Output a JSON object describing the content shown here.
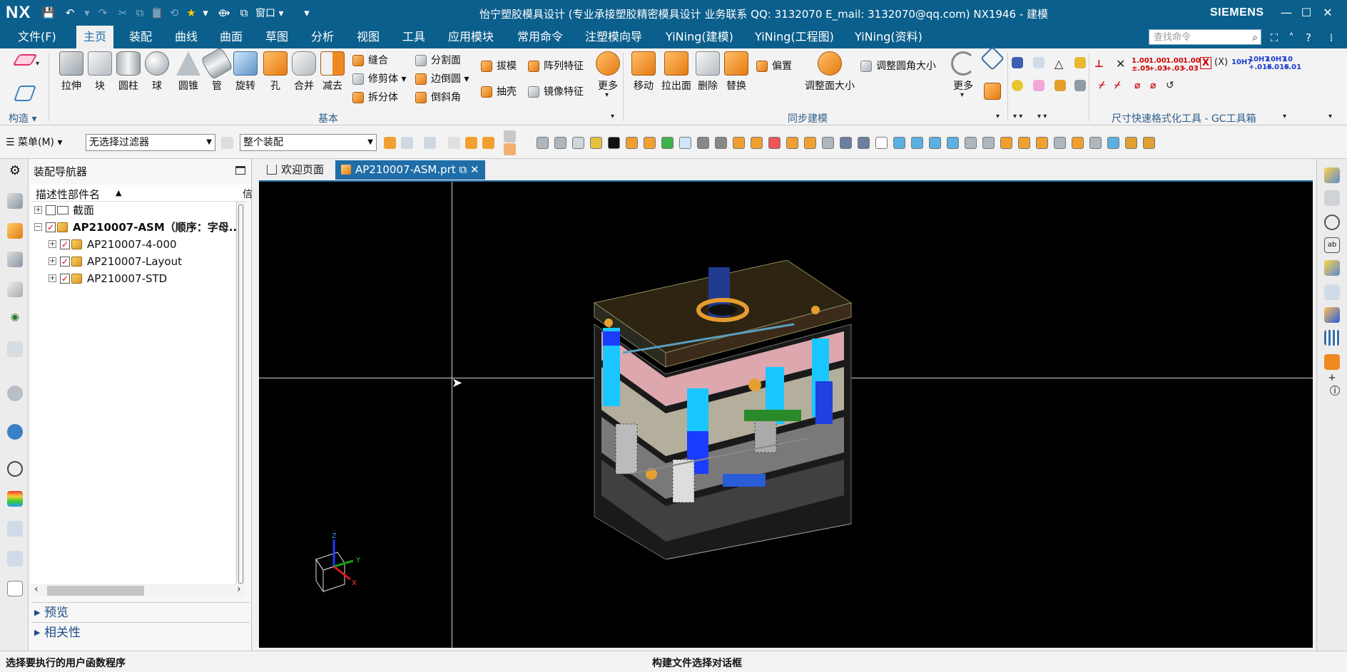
{
  "app": {
    "logo": "NX",
    "window_menu": "窗口",
    "title": "怡宁塑胶模具设计 (专业承接塑胶精密模具设计 业务联系 QQ: 3132070    E_mail: 3132070@qq.com)  NX1946 - 建模",
    "brand": "SIEMENS"
  },
  "menubar": {
    "items": [
      "文件(F)",
      "主页",
      "装配",
      "曲线",
      "曲面",
      "草图",
      "分析",
      "视图",
      "工具",
      "应用模块",
      "常用命令",
      "注塑模向导",
      "YiNing(建模)",
      "YiNing(工程图)",
      "YiNing(资料)"
    ],
    "active_index": 1,
    "search_placeholder": "查找命令"
  },
  "ribbon": {
    "construct": {
      "label": "构造"
    },
    "basic": {
      "label": "基本",
      "large": [
        "拉伸",
        "块",
        "圆柱",
        "球",
        "圆锥",
        "管",
        "旋转",
        "孔",
        "合并",
        "减去"
      ],
      "small_col1": [
        "缝合",
        "修剪体",
        "拆分体"
      ],
      "small_col2": [
        "分割面",
        "边倒圆",
        "倒斜角"
      ],
      "small_col3": [
        "拔模",
        "抽壳"
      ],
      "small_col4": [
        "阵列特征",
        "镜像特征"
      ],
      "more": "更多"
    },
    "sync": {
      "label": "同步建模",
      "large": [
        "移动",
        "拉出面",
        "删除",
        "替换"
      ],
      "offset": "偏置",
      "resize_fillet": "调整圆角大小",
      "resize": "调整面大小",
      "more": "更多"
    },
    "gc": {
      "label": "尺寸快速格式化工具 - GC工具箱",
      "tiny": [
        "1.00\n±.05",
        "1.00\n+.03",
        "1.00\n+.03",
        "1.00\n-.03",
        "10H7",
        "10H7\n+.015",
        "10H7\n+.015",
        "10\n+.01"
      ]
    }
  },
  "selbar": {
    "menu": "菜单(M)",
    "filter": "无选择过滤器",
    "scope": "整个装配"
  },
  "navigator": {
    "title": "装配导航器",
    "col1": "描述性部件名",
    "col2": "信",
    "rows": [
      {
        "label": "截面",
        "bold": false,
        "level": 0,
        "expander": "+",
        "checked": false,
        "icon": "folder"
      },
      {
        "label": "AP210007-ASM（顺序：字母...",
        "bold": true,
        "level": 0,
        "expander": "−",
        "checked": true,
        "icon": "assembly"
      },
      {
        "label": "AP210007-4-000",
        "bold": false,
        "level": 1,
        "expander": "+",
        "checked": true,
        "icon": "assembly"
      },
      {
        "label": "AP210007-Layout",
        "bold": false,
        "level": 1,
        "expander": "+",
        "checked": true,
        "icon": "assembly"
      },
      {
        "label": "AP210007-STD",
        "bold": false,
        "level": 1,
        "expander": "+",
        "checked": true,
        "icon": "assembly"
      }
    ],
    "sections": [
      "预览",
      "相关性"
    ]
  },
  "tabs": [
    {
      "label": "欢迎页面",
      "active": false
    },
    {
      "label": "AP210007-ASM.prt",
      "active": true
    }
  ],
  "viewport": {
    "triad": {
      "x": "X",
      "y": "Y",
      "z": "Z"
    }
  },
  "status": {
    "left": "选择要执行的用户函数程序",
    "center": "构建文件选择对话框"
  },
  "colors": {
    "accent": "#0b5f8c",
    "tab_active": "#1f6ea8",
    "viewport_bg": "#000000"
  }
}
